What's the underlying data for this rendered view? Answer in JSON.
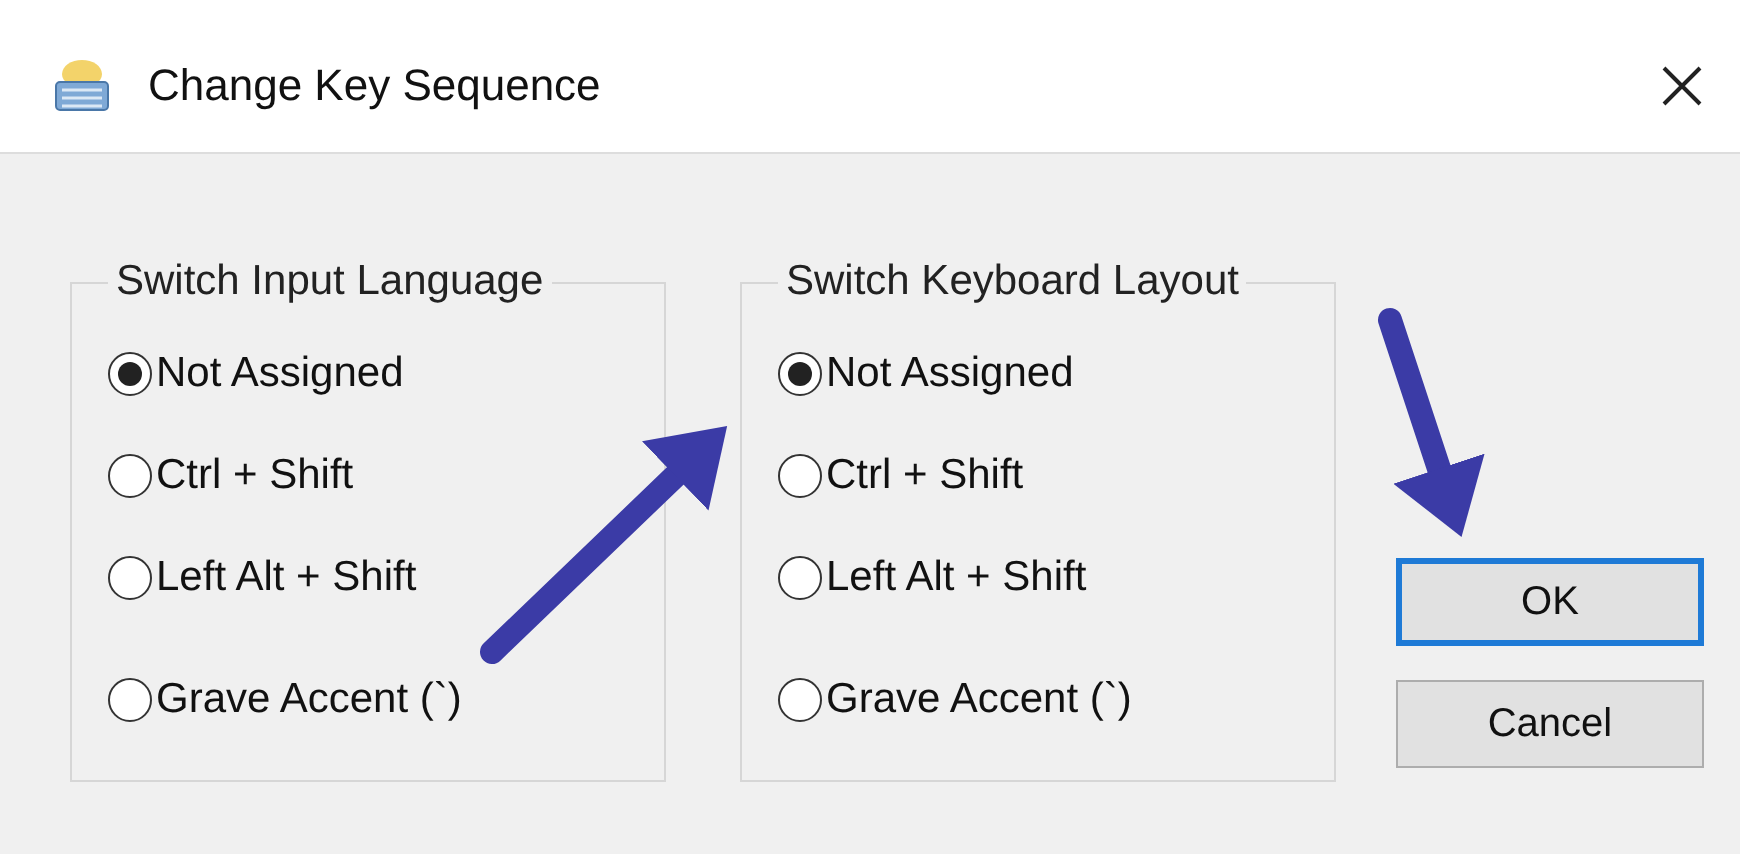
{
  "window": {
    "title": "Change Key Sequence"
  },
  "groups": [
    {
      "legend": "Switch Input Language",
      "options": [
        {
          "label": "Not Assigned",
          "selected": true
        },
        {
          "label": "Ctrl + Shift",
          "selected": false
        },
        {
          "label": "Left Alt + Shift",
          "selected": false
        },
        {
          "label": "Grave Accent (`)",
          "selected": false
        }
      ]
    },
    {
      "legend": "Switch Keyboard Layout",
      "options": [
        {
          "label": "Not Assigned",
          "selected": true
        },
        {
          "label": "Ctrl + Shift",
          "selected": false
        },
        {
          "label": "Left Alt + Shift",
          "selected": false
        },
        {
          "label": "Grave Accent (`)",
          "selected": false
        }
      ]
    }
  ],
  "buttons": [
    {
      "label": "OK",
      "default": true
    },
    {
      "label": "Cancel",
      "default": false
    }
  ]
}
